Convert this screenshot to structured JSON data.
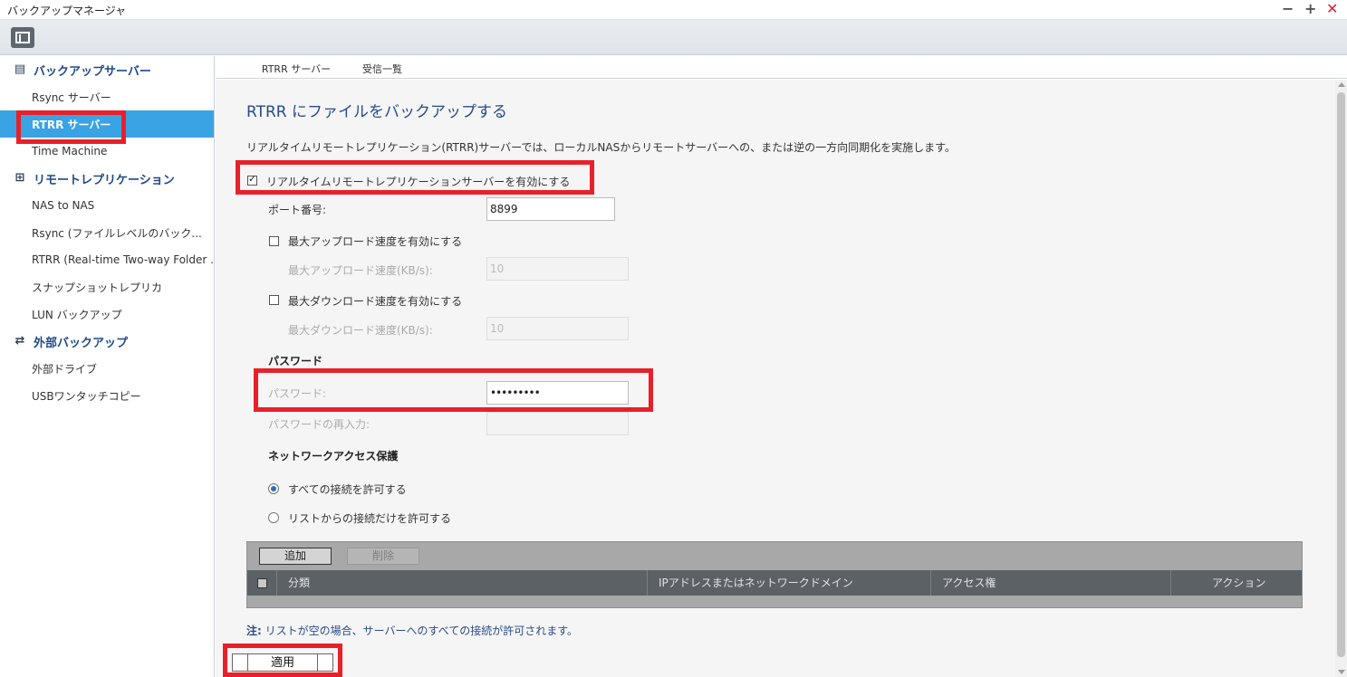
{
  "window": {
    "title": "バックアップマネージャ",
    "minimize_icon": "minimize-icon",
    "maximize_icon": "maximize-icon",
    "close_icon": "close-icon"
  },
  "toolbar": {
    "layout_icon": "layout-panel-icon"
  },
  "sidebar": {
    "groups": [
      {
        "label": "バックアップサーバー",
        "icon": "server-icon"
      },
      {
        "label": "リモートレプリケーション",
        "icon": "replication-icon"
      },
      {
        "label": "外部バックアップ",
        "icon": "sync-arrows-icon"
      }
    ],
    "items": [
      {
        "label": "Rsync サーバー"
      },
      {
        "label": "RTRR サーバー"
      },
      {
        "label": "Time Machine"
      },
      {
        "label": "NAS to NAS"
      },
      {
        "label": "Rsync (ファイルレベルのバック..."
      },
      {
        "label": "RTRR (Real-time Two-way Folder ..."
      },
      {
        "label": "スナップショットレプリカ"
      },
      {
        "label": "LUN バックアップ"
      },
      {
        "label": "外部ドライブ"
      },
      {
        "label": "USBワンタッチコピー"
      }
    ],
    "active_item": "RTRR サーバー"
  },
  "tabs": [
    {
      "label": "RTRR サーバー",
      "active": true
    },
    {
      "label": "受信一覧",
      "active": false
    }
  ],
  "main": {
    "heading": "RTRR にファイルをバックアップする",
    "description": "リアルタイムリモートレプリケーション(RTRR)サーバーでは、ローカルNASからリモートサーバーへの、または逆の一方向同期化を実施します。",
    "enable_server": {
      "label": "リアルタイムリモートレプリケーションサーバーを有効にする",
      "checked": true
    },
    "port": {
      "label": "ポート番号:",
      "value": "8899"
    },
    "upload": {
      "enable_label": "最大アップロード速度を有効にする",
      "checked": false,
      "speed_label": "最大アップロード速度(KB/s):",
      "speed_value": "10"
    },
    "download": {
      "enable_label": "最大ダウンロード速度を有効にする",
      "checked": false,
      "speed_label": "最大ダウンロード速度(KB/s):",
      "speed_value": "10"
    },
    "password_section": {
      "title": "パスワード",
      "password_label": "パスワード:",
      "password_value": "•••••••••",
      "confirm_label": "パスワードの再入力:",
      "confirm_value": ""
    },
    "network_access": {
      "title": "ネットワークアクセス保護",
      "options": [
        {
          "label": "すべての接続を許可する",
          "checked": true
        },
        {
          "label": "リストからの接続だけを許可する",
          "checked": false
        }
      ]
    },
    "table": {
      "add_label": "追加",
      "delete_label": "削除",
      "columns": [
        "分類",
        "IPアドレスまたはネットワークドメイン",
        "アクセス権",
        "アクション"
      ],
      "rows": []
    },
    "note_prefix": "注:",
    "note_text": " リストが空の場合、サーバーへのすべての接続が許可されます。",
    "apply_label": "適用"
  },
  "colors": {
    "highlight_red": "#e8202a",
    "active_blue": "#3aa3e3",
    "heading_blue": "#274b8c"
  }
}
